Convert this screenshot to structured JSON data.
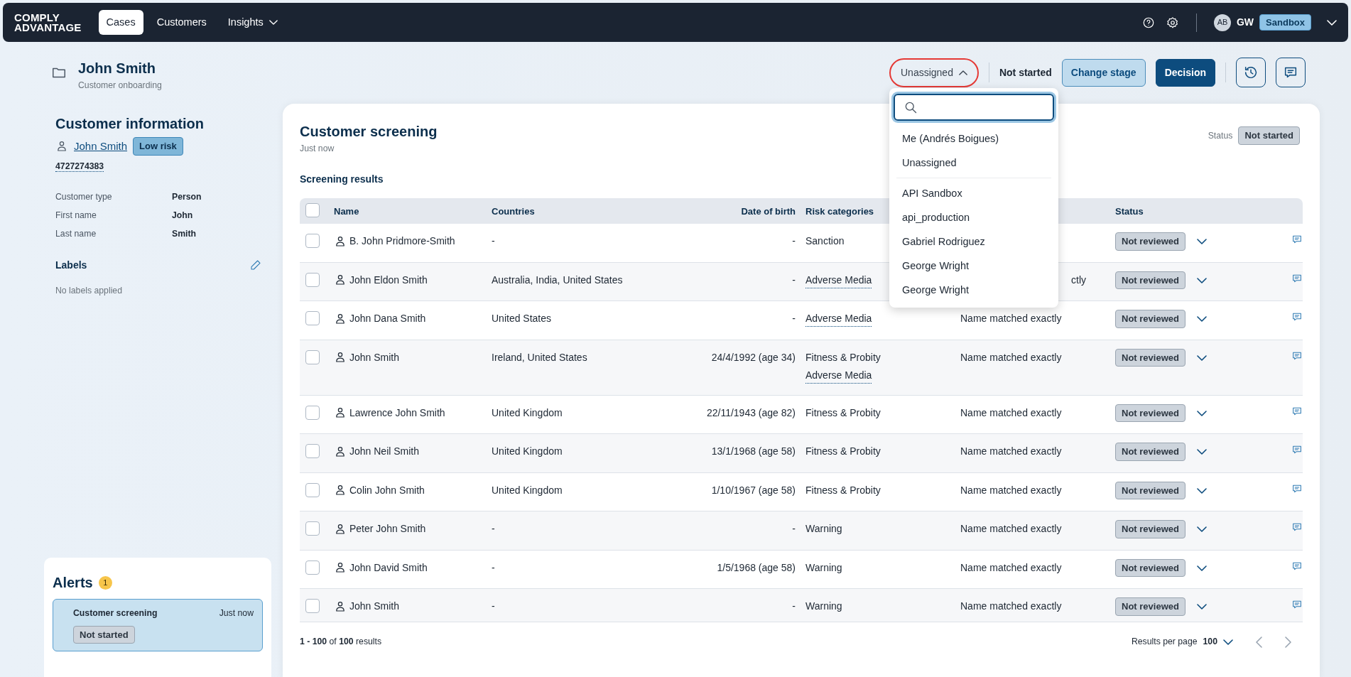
{
  "nav": {
    "logo_lines": [
      "COMPLY",
      "ADVANTAGE"
    ],
    "tabs": [
      {
        "label": "Cases",
        "selected": true,
        "has_menu": false
      },
      {
        "label": "Customers",
        "selected": false,
        "has_menu": false
      },
      {
        "label": "Insights",
        "selected": false,
        "has_menu": true
      }
    ],
    "avatar": "AB",
    "user": "GW",
    "environment": "Sandbox"
  },
  "case": {
    "title": "John Smith",
    "subtitle": "Customer onboarding",
    "assignee": "Unassigned",
    "assignee_open": true,
    "stage": "Not started",
    "buttons": [
      {
        "label": "Change stage",
        "kind": "secondary"
      },
      {
        "label": "Decision",
        "kind": "primary"
      }
    ]
  },
  "assignee_menu": {
    "groups": [
      [
        "Me (Andrés Boigues)",
        "Unassigned"
      ],
      [
        "API Sandbox",
        "api_production",
        "Gabriel Rodriguez",
        "George Wright",
        "George Wright"
      ]
    ]
  },
  "customer": {
    "heading": "Customer information",
    "name": "John Smith",
    "risk": "Low risk",
    "id": "4727274383",
    "fields": [
      {
        "label": "Customer type",
        "value": "Person"
      },
      {
        "label": "First name",
        "value": "John"
      },
      {
        "label": "Last name",
        "value": "Smith"
      }
    ],
    "labels_heading": "Labels",
    "labels_empty": "No labels applied"
  },
  "alerts": {
    "heading": "Alerts",
    "count": "1",
    "items": [
      {
        "title": "Customer screening",
        "time": "Just now",
        "status": "Not started",
        "selected": true
      }
    ]
  },
  "screening": {
    "title": "Customer screening",
    "time": "Just now",
    "status_label": "Status",
    "status": "Not started",
    "section": "Screening results",
    "all_checked": false,
    "columns": [
      "Name",
      "Countries",
      "Date of birth",
      "Risk categories",
      "Status"
    ],
    "rows": [
      {
        "name": "B. John Pridmore-Smith",
        "countries": "-",
        "dob": "-",
        "risks": [
          {
            "label": "Sanction",
            "linked": false
          }
        ],
        "status": "Not reviewed",
        "checked": false
      },
      {
        "name": "John Eldon Smith",
        "countries": "Australia, India, United States",
        "dob": "-",
        "risks": [
          {
            "label": "Adverse Media",
            "linked": true
          }
        ],
        "match": "ctly",
        "match_covered": true,
        "status": "Not reviewed",
        "checked": false
      },
      {
        "name": "John Dana Smith",
        "countries": "United States",
        "dob": "-",
        "risks": [
          {
            "label": "Adverse Media",
            "linked": true
          }
        ],
        "match": "Name matched exactly",
        "match_covered": false,
        "status": "Not reviewed",
        "checked": false
      },
      {
        "name": "John Smith",
        "countries": "Ireland, United States",
        "dob": "24/4/1992 (age 34)",
        "risks": [
          {
            "label": "Fitness & Probity",
            "linked": false
          },
          {
            "label": "Adverse Media",
            "linked": true
          }
        ],
        "match": "Name matched exactly",
        "match_covered": false,
        "status": "Not reviewed",
        "checked": false
      },
      {
        "name": "Lawrence John Smith",
        "countries": "United Kingdom",
        "dob": "22/11/1943 (age 82)",
        "risks": [
          {
            "label": "Fitness & Probity",
            "linked": false
          }
        ],
        "match": "Name matched exactly",
        "match_covered": false,
        "status": "Not reviewed",
        "checked": false
      },
      {
        "name": "John Neil Smith",
        "countries": "United Kingdom",
        "dob": "13/1/1968 (age 58)",
        "risks": [
          {
            "label": "Fitness & Probity",
            "linked": false
          }
        ],
        "match": "Name matched exactly",
        "match_covered": false,
        "status": "Not reviewed",
        "checked": false
      },
      {
        "name": "Colin John Smith",
        "countries": "United Kingdom",
        "dob": "1/10/1967 (age 58)",
        "risks": [
          {
            "label": "Fitness & Probity",
            "linked": false
          }
        ],
        "match": "Name matched exactly",
        "match_covered": false,
        "status": "Not reviewed",
        "checked": false
      },
      {
        "name": "Peter John Smith",
        "countries": "-",
        "dob": "-",
        "risks": [
          {
            "label": "Warning",
            "linked": false
          }
        ],
        "match": "Name matched exactly",
        "match_covered": false,
        "status": "Not reviewed",
        "checked": false
      },
      {
        "name": "John David Smith",
        "countries": "-",
        "dob": "1/5/1968 (age 58)",
        "risks": [
          {
            "label": "Warning",
            "linked": false
          }
        ],
        "match": "Name matched exactly",
        "match_covered": false,
        "status": "Not reviewed",
        "checked": false
      },
      {
        "name": "John Smith",
        "countries": "-",
        "dob": "-",
        "risks": [
          {
            "label": "Warning",
            "linked": false
          }
        ],
        "match": "Name matched exactly",
        "match_covered": false,
        "status": "Not reviewed",
        "checked": false
      }
    ],
    "summary": "**1 - 100** of **100** results",
    "per_page_label": "Results per page",
    "per_page": "100"
  }
}
